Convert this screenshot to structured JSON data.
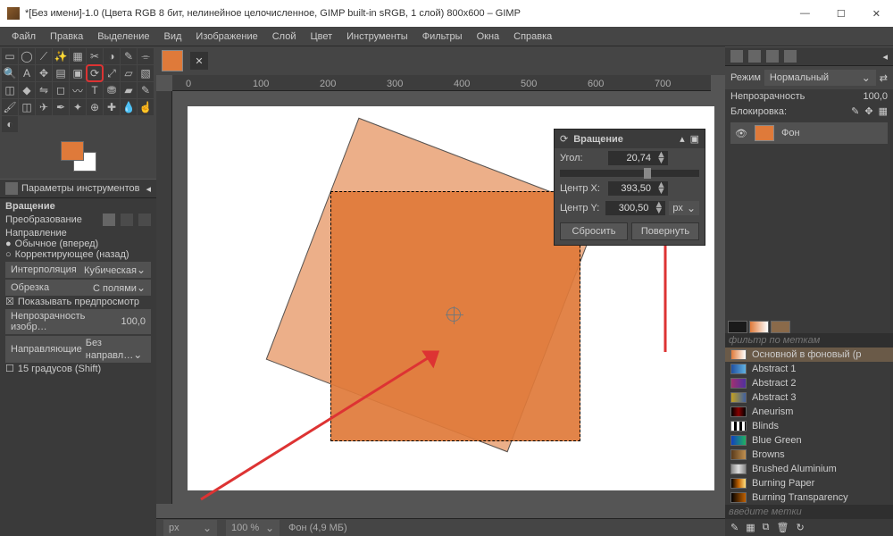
{
  "titlebar": "*[Без имени]-1.0 (Цвета RGB 8 бит, нелинейное целочисленное, GIMP built-in sRGB, 1 слой) 800x600 – GIMP",
  "menus": [
    "Файл",
    "Правка",
    "Выделение",
    "Вид",
    "Изображение",
    "Слой",
    "Цвет",
    "Инструменты",
    "Фильтры",
    "Окна",
    "Справка"
  ],
  "ruler_ticks": [
    "0",
    "100",
    "200",
    "300",
    "400",
    "500",
    "600",
    "700"
  ],
  "tool_options": {
    "header": "Параметры инструментов",
    "tool_name": "Вращение",
    "transform_label": "Преобразование",
    "direction_label": "Направление",
    "direction_normal": "Обычное (вперед)",
    "direction_corrective": "Корректирующее (назад)",
    "interp_label": "Интерполяция",
    "interp_value": "Кубическая",
    "clip_label": "Обрезка",
    "clip_value": "С полями",
    "show_preview": "Показывать предпросмотр",
    "opacity_label": "Непрозрачность изобр…",
    "opacity_value": "100,0",
    "guides_label": "Направляющие",
    "guides_value": "Без направл…",
    "fifteen": "15 градусов (Shift)"
  },
  "dialog": {
    "title": "Вращение",
    "angle_label": "Угол:",
    "angle_value": "20,74",
    "cx_label": "Центр X:",
    "cx_value": "393,50",
    "cy_label": "Центр Y:",
    "cy_value": "300,50",
    "unit": "px",
    "reset": "Сбросить",
    "rotate": "Повернуть"
  },
  "status": {
    "unit": "px",
    "zoom": "100 %",
    "layer": "Фон (4,9 МБ)"
  },
  "right": {
    "mode_label": "Режим",
    "mode_value": "Нормальный",
    "opacity_label": "Непрозрачность",
    "opacity_value": "100,0",
    "lock_label": "Блокировка:",
    "layer_label": "Фон",
    "filter_placeholder": "фильтр по меткам",
    "tag_placeholder": "введите метки",
    "gradients": [
      {
        "name": "Основной в фоновый (р",
        "bg": "linear-gradient(90deg,#df7a3a,#fff)",
        "sel": true
      },
      {
        "name": "Abstract 1",
        "bg": "linear-gradient(90deg,#2050a0,#60b0e0)"
      },
      {
        "name": "Abstract 2",
        "bg": "linear-gradient(90deg,#a03070,#5030a0)"
      },
      {
        "name": "Abstract 3",
        "bg": "linear-gradient(90deg,#c3a020,#4060a0)"
      },
      {
        "name": "Aneurism",
        "bg": "linear-gradient(90deg,#000,#800,#000)"
      },
      {
        "name": "Blinds",
        "bg": "repeating-linear-gradient(90deg,#fff 0 3px,#000 3px 6px)"
      },
      {
        "name": "Blue Green",
        "bg": "linear-gradient(90deg,#1040c0,#20b060)"
      },
      {
        "name": "Browns",
        "bg": "linear-gradient(90deg,#5a3a1b,#c09050)"
      },
      {
        "name": "Brushed Aluminium",
        "bg": "linear-gradient(90deg,#888,#ddd,#888)"
      },
      {
        "name": "Burning Paper",
        "bg": "linear-gradient(90deg,#000,#c06000,#ffe080)"
      },
      {
        "name": "Burning Transparency",
        "bg": "linear-gradient(90deg,#000,#c06000)"
      }
    ]
  }
}
